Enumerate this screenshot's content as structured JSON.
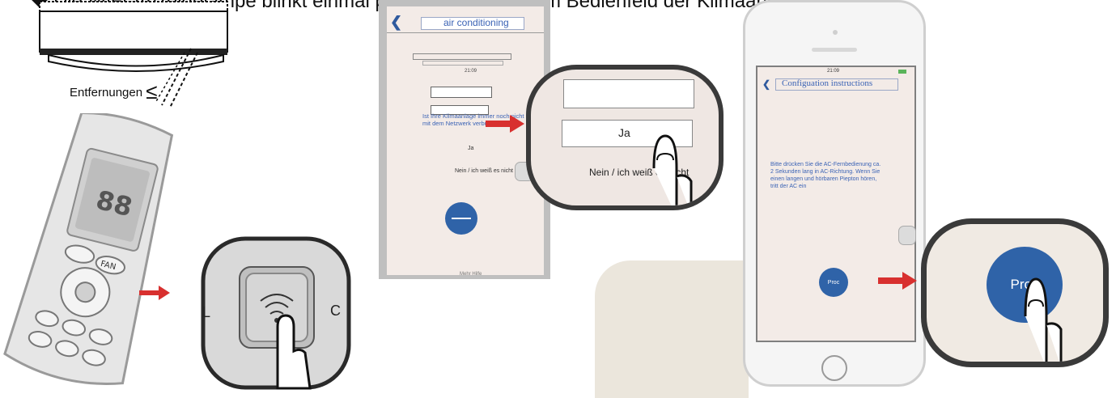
{
  "caption": "Die WiFi-Anzeigelampe blinkt einmal pro Sekunde auf dem Bedienfeld der Klimaanlage.",
  "distance_label": "Entfernungen",
  "distance_symbol": "≤",
  "remote": {
    "fan_label": "FAN",
    "display_digits": "88",
    "zoom_left_letter": "L",
    "zoom_right_letter": "C"
  },
  "screen1": {
    "title": "air conditioning",
    "time": "21:09",
    "question": "Ist Ihre Klimaanlage immer noch nicht mit dem Netzwerk verbunden?",
    "yes": "Ja",
    "no": "Nein / ich weiß es nicht",
    "footer": "Mehr Hilfe"
  },
  "zoom1": {
    "yes": "Ja",
    "no": "Nein / ich weiß es nicht"
  },
  "screen2": {
    "time": "21:09",
    "title": "Configuation instructions",
    "instruction": "Bitte drücken Sie die AC-Fernbedienung ca. 2 Sekunden lang in AC-Richtung. Wenn Sie einen langen und hörbaren Piepton hören, tritt der AC ein",
    "button": "Proc"
  },
  "zoom2": {
    "button": "Proc"
  },
  "colors": {
    "arrow": "#d8302f",
    "link_blue": "#3b63b5",
    "button_blue": "#2f63a8",
    "screen_bg": "#f3ebe7"
  }
}
